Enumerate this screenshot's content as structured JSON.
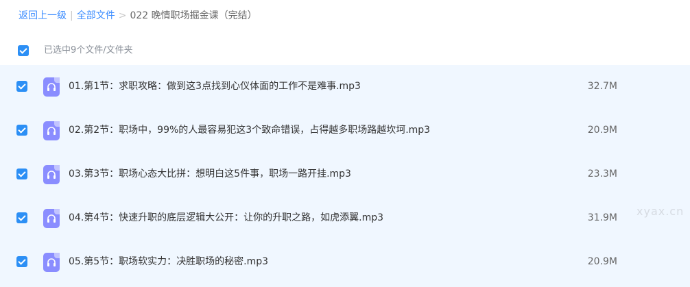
{
  "breadcrumb": {
    "back": "返回上一级",
    "separator1": "|",
    "all_files": "全部文件",
    "separator2": ">",
    "current": "022 晚情职场掘金课（完结）"
  },
  "selection": {
    "checked": true,
    "text": "已选中9个文件/文件夹"
  },
  "files": [
    {
      "name": "01.第1节：求职攻略：做到这3点找到心仪体面的工作不是难事.mp3",
      "size": "32.7M",
      "checked": true,
      "icon": "headphones-icon"
    },
    {
      "name": "02.第2节：职场中，99%的人最容易犯这3个致命错误，占得越多职场路越坎坷.mp3",
      "size": "20.9M",
      "checked": true,
      "icon": "headphones-icon"
    },
    {
      "name": "03.第3节：职场心态大比拼：想明白这5件事，职场一路开挂.mp3",
      "size": "23.3M",
      "checked": true,
      "icon": "headphones-icon"
    },
    {
      "name": "04.第4节：快速升职的底层逻辑大公开：让你的升职之路，如虎添翼.mp3",
      "size": "31.9M",
      "checked": true,
      "icon": "headphones-icon"
    },
    {
      "name": "05.第5节：职场软实力：决胜职场的秘密.mp3",
      "size": "20.9M",
      "checked": true,
      "icon": "headphones-icon"
    }
  ],
  "watermark": "xyax.cn",
  "colors": {
    "accent": "#2c8ff5",
    "link": "#3b8cff",
    "row_background": "#f0f7ff",
    "audio_icon": "#8a8dff"
  }
}
